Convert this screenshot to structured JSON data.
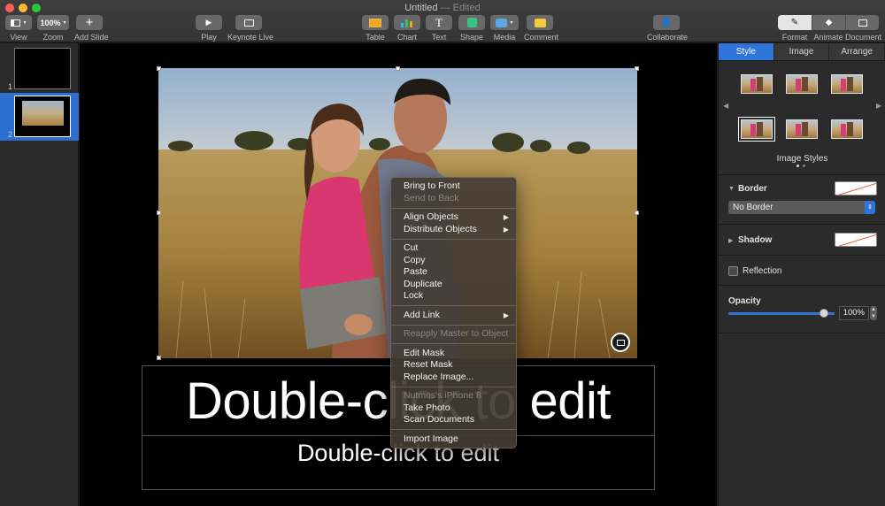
{
  "window": {
    "title": "Untitled",
    "status": "— Edited"
  },
  "toolbar": {
    "view": {
      "label": "View",
      "icon": "sidebar-view-icon"
    },
    "zoom": {
      "label": "Zoom",
      "value": "100%"
    },
    "add_slide": {
      "label": "Add Slide",
      "icon": "plus-icon"
    },
    "play": {
      "label": "Play",
      "icon": "play-icon"
    },
    "keynote_live": {
      "label": "Keynote Live",
      "icon": "broadcast-icon"
    },
    "table": {
      "label": "Table",
      "icon": "table-icon"
    },
    "chart": {
      "label": "Chart",
      "icon": "chart-icon"
    },
    "text": {
      "label": "Text",
      "icon": "text-icon"
    },
    "shape": {
      "label": "Shape",
      "icon": "shape-icon"
    },
    "media": {
      "label": "Media",
      "icon": "media-icon"
    },
    "comment": {
      "label": "Comment",
      "icon": "comment-icon"
    },
    "collaborate": {
      "label": "Collaborate",
      "icon": "collaborate-icon"
    },
    "format": {
      "label": "Format",
      "icon": "paintbrush-icon"
    },
    "animate": {
      "label": "Animate",
      "icon": "diamond-icon"
    },
    "document": {
      "label": "Document",
      "icon": "document-icon"
    }
  },
  "navigator": {
    "slides": [
      {
        "number": "1",
        "selected": false
      },
      {
        "number": "2",
        "selected": true
      }
    ]
  },
  "slide": {
    "title_placeholder": "Double-click to edit",
    "subtitle_placeholder": "Double-click to edit"
  },
  "context_menu": {
    "items": [
      {
        "label": "Bring to Front",
        "enabled": true
      },
      {
        "label": "Send to Back",
        "enabled": false
      },
      {
        "label": "Align Objects",
        "enabled": true,
        "submenu": true
      },
      {
        "label": "Distribute Objects",
        "enabled": true,
        "submenu": true
      },
      {
        "label": "Cut",
        "enabled": true
      },
      {
        "label": "Copy",
        "enabled": true
      },
      {
        "label": "Paste",
        "enabled": true
      },
      {
        "label": "Duplicate",
        "enabled": true
      },
      {
        "label": "Lock",
        "enabled": true
      },
      {
        "label": "Add Link",
        "enabled": true,
        "submenu": true
      },
      {
        "label": "Reapply Master to Object",
        "enabled": false
      },
      {
        "label": "Edit Mask",
        "enabled": true
      },
      {
        "label": "Reset Mask",
        "enabled": true
      },
      {
        "label": "Replace Image...",
        "enabled": true
      },
      {
        "label": "Nutmos's iPhone 8",
        "enabled": false
      },
      {
        "label": "Take Photo",
        "enabled": true
      },
      {
        "label": "Scan Documents",
        "enabled": true
      },
      {
        "label": "Import Image",
        "enabled": true
      }
    ]
  },
  "inspector": {
    "tabs": [
      "Style",
      "Image",
      "Arrange"
    ],
    "active_tab": "Style",
    "image_styles_label": "Image Styles",
    "border": {
      "label": "Border",
      "value": "No Border"
    },
    "shadow": {
      "label": "Shadow"
    },
    "reflection": {
      "label": "Reflection",
      "checked": false
    },
    "opacity": {
      "label": "Opacity",
      "value": "100%",
      "level": 1.0
    }
  },
  "colors": {
    "accent": "#2f74d9",
    "toolbar_bg": "#3a3a3a",
    "canvas_bg": "#000000"
  }
}
